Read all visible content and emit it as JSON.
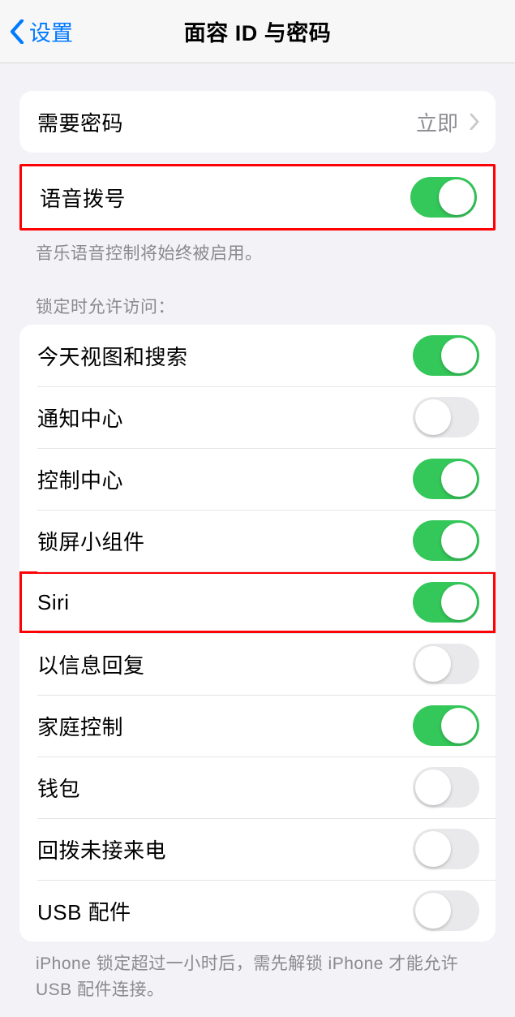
{
  "header": {
    "back_label": "设置",
    "title": "面容 ID 与密码"
  },
  "require_passcode": {
    "label": "需要密码",
    "value": "立即"
  },
  "voice_dial": {
    "label": "语音拨号",
    "on": true,
    "footnote": "音乐语音控制将始终被启用。"
  },
  "lock_section": {
    "header": "锁定时允许访问："
  },
  "lock_items": [
    {
      "label": "今天视图和搜索",
      "on": true,
      "highlight": false
    },
    {
      "label": "通知中心",
      "on": false,
      "highlight": false
    },
    {
      "label": "控制中心",
      "on": true,
      "highlight": false
    },
    {
      "label": "锁屏小组件",
      "on": true,
      "highlight": false
    },
    {
      "label": "Siri",
      "on": true,
      "highlight": true
    },
    {
      "label": "以信息回复",
      "on": false,
      "highlight": false
    },
    {
      "label": "家庭控制",
      "on": true,
      "highlight": false
    },
    {
      "label": "钱包",
      "on": false,
      "highlight": false
    },
    {
      "label": "回拨未接来电",
      "on": false,
      "highlight": false
    },
    {
      "label": "USB 配件",
      "on": false,
      "highlight": false
    }
  ],
  "usb_footnote": "iPhone 锁定超过一小时后，需先解锁 iPhone 才能允许 USB 配件连接。"
}
